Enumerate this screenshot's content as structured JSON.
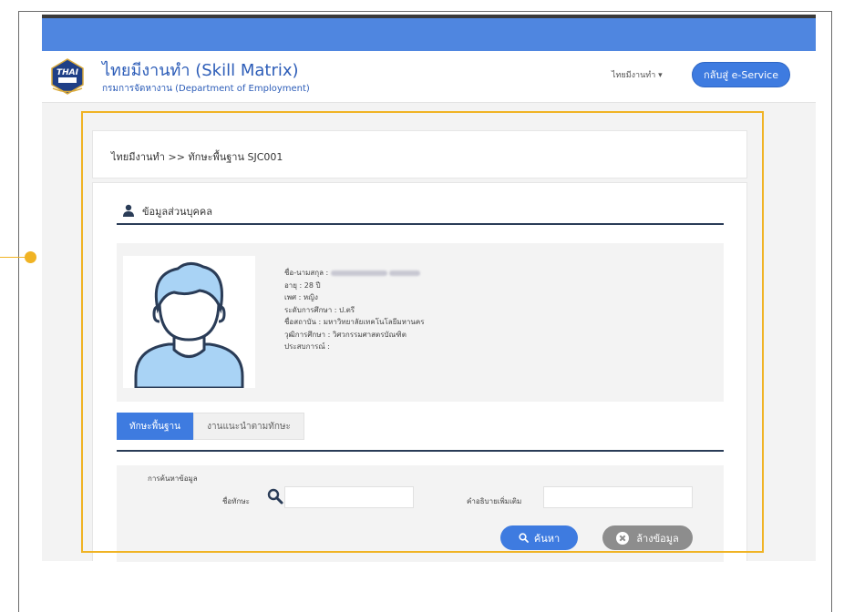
{
  "header": {
    "app_title": "ไทยมีงานทำ (Skill Matrix)",
    "app_subtitle": "กรมการจัดหางาน (Department of Employment)",
    "logo_text": "THAI มีงานทำ",
    "nav_menu": "ไทยมีงานทำ ▾",
    "eservice_label": "กลับสู่ e-Service"
  },
  "breadcrumb": "ไทยมีงานทำ >> ทักษะพื้นฐาน SJC001",
  "profile": {
    "section_title": "ข้อมูลส่วนบุคคล",
    "name_label": "ชื่อ-นามสกุล :",
    "age_label": "อายุ :",
    "age_value": "28 ปี",
    "gender_label": "เพศ :",
    "gender_value": "หญิง",
    "education_level_label": "ระดับการศึกษา :",
    "education_level_value": "ป.ตรี",
    "institution_label": "ชื่อสถาบัน :",
    "institution_value": "มหาวิทยาลัยเทคโนโลยีมหานคร",
    "degree_label": "วุฒิการศึกษา :",
    "degree_value": "วิศวกรรมศาสตรบัณฑิต",
    "experience_label": "ประสบการณ์ :",
    "experience_value": ""
  },
  "tabs": [
    {
      "label": "ทักษะพื้นฐาน",
      "active": true
    },
    {
      "label": "งานแนะนำตามทักษะ",
      "active": false
    }
  ],
  "search": {
    "heading": "การค้นหาข้อมูล",
    "skill_label": "ชื่อทักษะ",
    "skill_value": "",
    "description_label": "คำอธิบายเพิ่มเติม",
    "description_value": "",
    "search_button": "ค้นหา",
    "clear_button": "ล้างข้อมูล"
  },
  "colors": {
    "primary_blue": "#3e7be0",
    "highlight": "#f0b324",
    "avatar_blue": "#a9d3f5",
    "avatar_outline": "#2a3c57"
  }
}
